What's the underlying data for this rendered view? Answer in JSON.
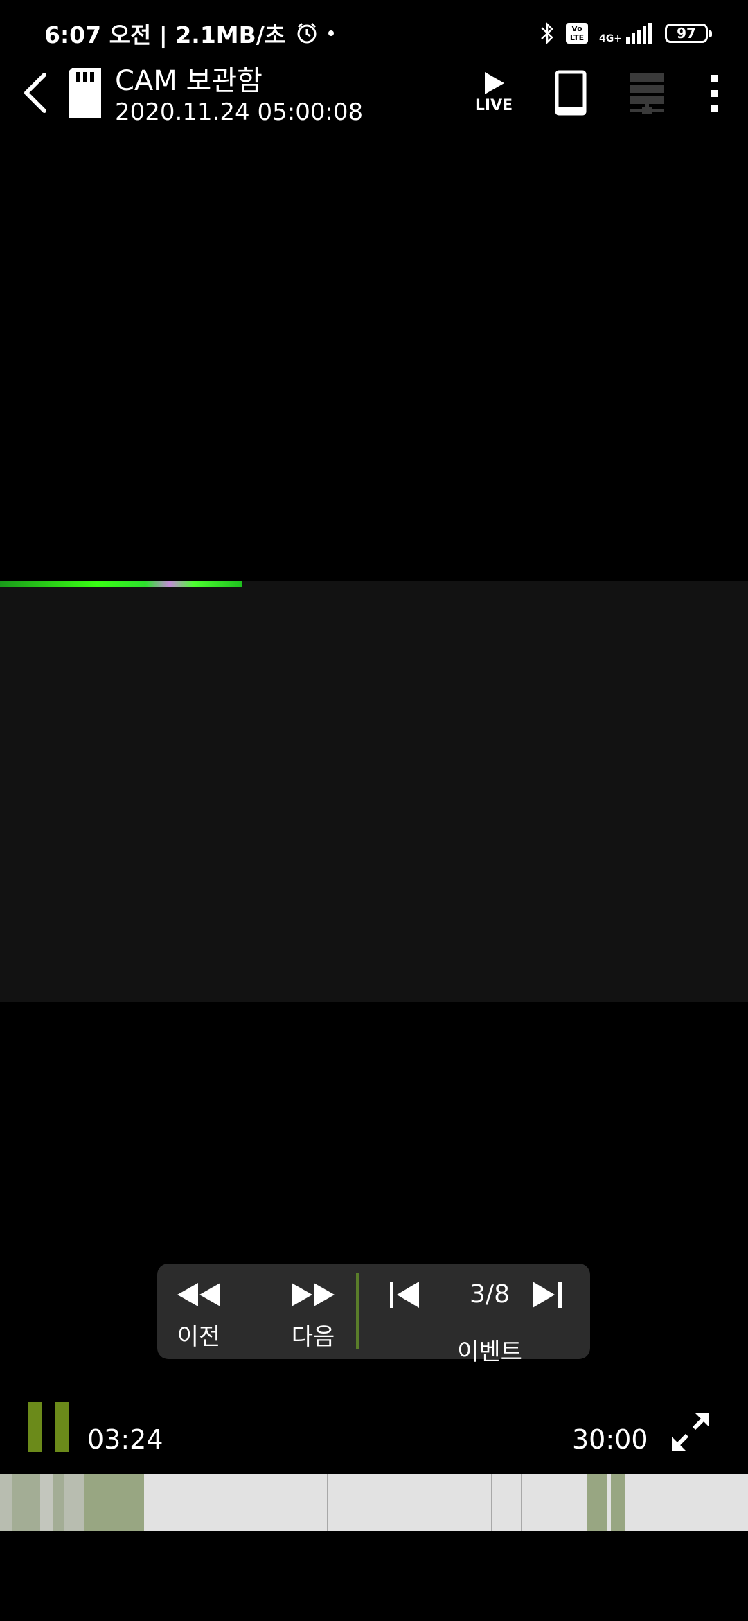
{
  "status_bar": {
    "time_text": "6:07 오전 | 2.1MB/초",
    "volte_label": "Vo LTE",
    "network_label": "4G+",
    "battery_level": "97"
  },
  "app_bar": {
    "title": "CAM 보관함",
    "subtitle": "2020.11.24 05:00:08",
    "live_label": "LIVE"
  },
  "playback_nav": {
    "prev_label": "이전",
    "next_label": "다음",
    "event_count": "3/8",
    "event_label": "이벤트"
  },
  "player": {
    "current_time": "03:24",
    "total_time": "30:00"
  },
  "colors": {
    "accent_green": "#6b8a1a",
    "timeline_event": "#8fa07a",
    "timeline_bg": "#e2e2e2"
  },
  "icons": [
    "back-icon",
    "sd-card-icon",
    "live-play-icon",
    "phone-icon",
    "server-icon",
    "more-icon",
    "rewind-icon",
    "fast-forward-icon",
    "skip-previous-icon",
    "skip-next-icon",
    "pause-icon",
    "expand-icon"
  ]
}
